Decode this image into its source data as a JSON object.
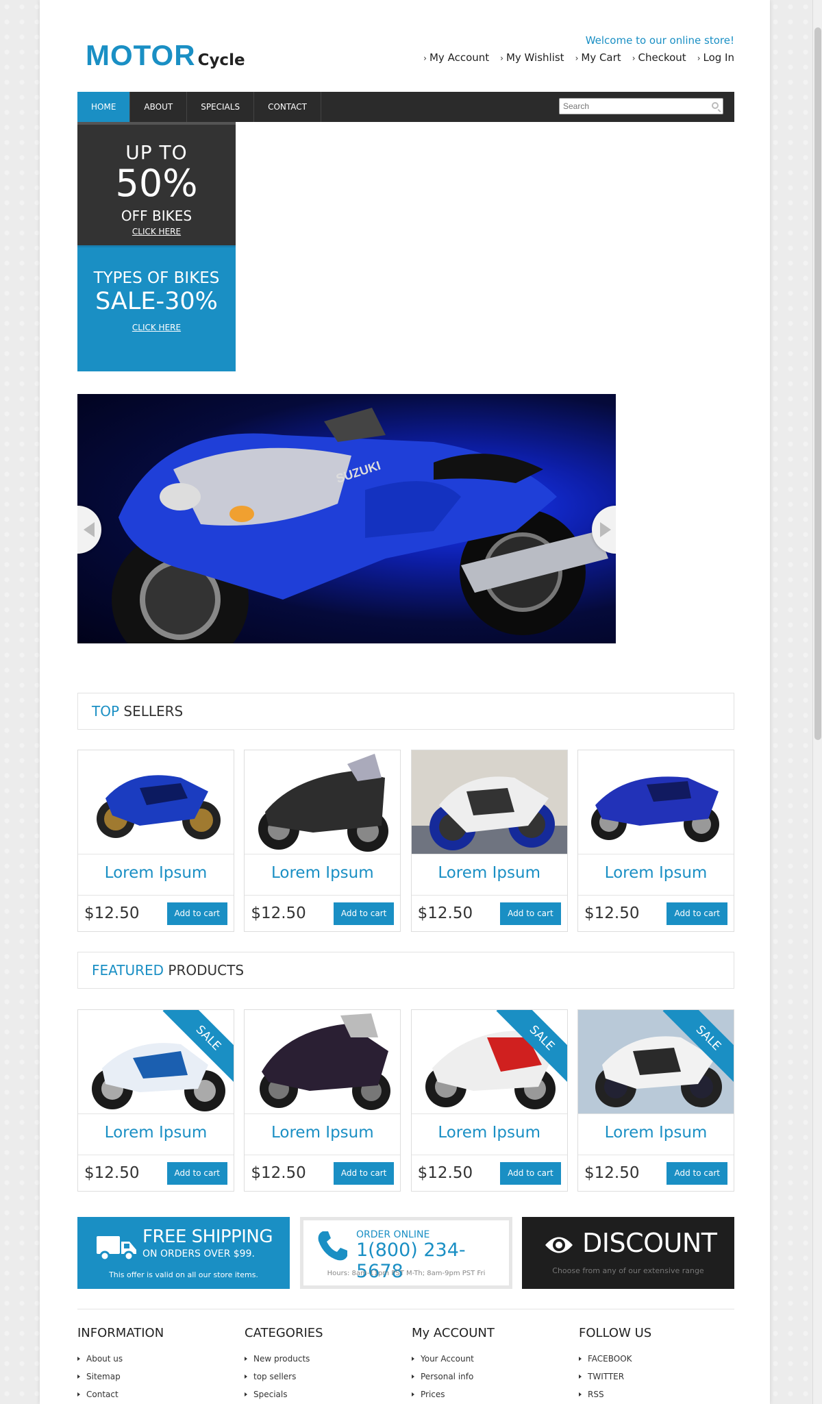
{
  "header": {
    "logo_main": "MOTOR",
    "logo_sub": "Cycle",
    "welcome": "Welcome to our online store!",
    "links": [
      "My Account",
      "My Wishlist",
      "My Cart",
      "Checkout",
      "Log In"
    ]
  },
  "nav": {
    "items": [
      "HOME",
      "ABOUT",
      "SPECIALS",
      "CONTACT"
    ],
    "active": "HOME",
    "search_placeholder": "Search"
  },
  "promo": {
    "box1": {
      "up_to": "UP TO",
      "percent": "50%",
      "off": "OFF BIKES",
      "link": "CLICK HERE"
    },
    "box2": {
      "types": "TYPES OF BIKES",
      "sale": "SALE-30%",
      "link": "CLICK HERE"
    }
  },
  "top_sellers": {
    "title_accent": "TOP",
    "title_rest": "SELLERS",
    "products": [
      {
        "name": "Lorem Ipsum",
        "price": "$12.50",
        "button": "Add to cart",
        "sale": false
      },
      {
        "name": "Lorem Ipsum",
        "price": "$12.50",
        "button": "Add to cart",
        "sale": false
      },
      {
        "name": "Lorem Ipsum",
        "price": "$12.50",
        "button": "Add to cart",
        "sale": false
      },
      {
        "name": "Lorem Ipsum",
        "price": "$12.50",
        "button": "Add to cart",
        "sale": false
      }
    ]
  },
  "featured": {
    "title_accent": "FEATURED",
    "title_rest": "PRODUCTS",
    "sale_label": "SALE",
    "products": [
      {
        "name": "Lorem Ipsum",
        "price": "$12.50",
        "button": "Add to cart",
        "sale": true
      },
      {
        "name": "Lorem Ipsum",
        "price": "$12.50",
        "button": "Add to cart",
        "sale": false
      },
      {
        "name": "Lorem Ipsum",
        "price": "$12.50",
        "button": "Add to cart",
        "sale": true
      },
      {
        "name": "Lorem Ipsum",
        "price": "$12.50",
        "button": "Add to cart",
        "sale": true
      }
    ]
  },
  "services": {
    "shipping": {
      "title": "FREE SHIPPING",
      "subtitle": "ON ORDERS OVER $99.",
      "note": "This offer is valid on all our store items."
    },
    "order": {
      "title": "ORDER ONLINE",
      "phone": "1(800) 234-5678",
      "hours": "Hours: 8am-11pm PST M-Th; 8am-9pm PST Fri"
    },
    "discount": {
      "title": "DISCOUNT",
      "note": "Choose from any of our extensive range"
    }
  },
  "footer": {
    "columns": [
      {
        "title": "INFORMATION",
        "items": [
          "About us",
          "Sitemap",
          "Contact"
        ]
      },
      {
        "title": "CATEGORIES",
        "items": [
          "New products",
          "top sellers",
          "Specials"
        ]
      },
      {
        "title": "My ACCOUNT",
        "items": [
          "Your Account",
          "Personal info",
          "Prices"
        ]
      },
      {
        "title": "FOLLOW US",
        "items": [
          "FACEBOOK",
          "TWITTER",
          "RSS"
        ]
      }
    ]
  },
  "colors": {
    "accent": "#1a8fc4",
    "nav_bg": "#2b2b2b",
    "promo_dark": "#333333",
    "discount_bg": "#1e1e1e"
  }
}
